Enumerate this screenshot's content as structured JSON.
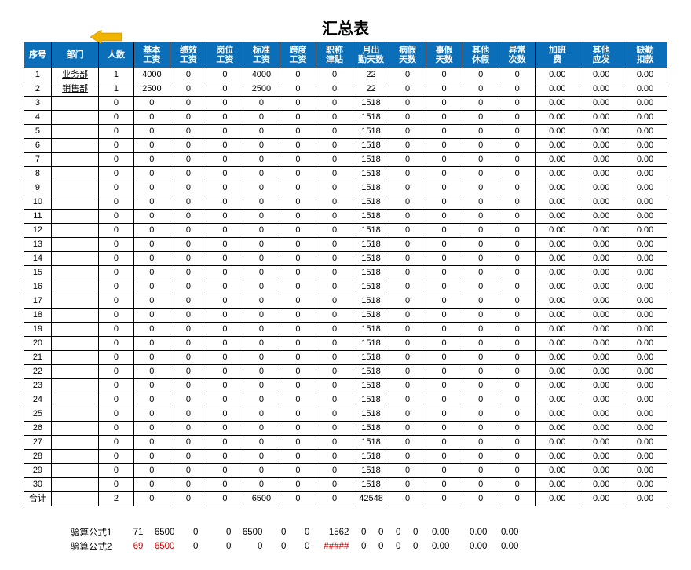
{
  "title": "汇总表",
  "headers": [
    "序号",
    "部门",
    "人数",
    "基本工资",
    "绩效工资",
    "岗位工资",
    "标准工资",
    "跨度工资",
    "职称津贴",
    "月出勤天数",
    "病假天数",
    "事假天数",
    "其他休假",
    "异常次数",
    "加班费",
    "其他应发",
    "缺勤扣款"
  ],
  "rows": [
    {
      "idx": "1",
      "dept": "业务部",
      "v": [
        "1",
        "4000",
        "0",
        "0",
        "4000",
        "0",
        "0",
        "22",
        "0",
        "0",
        "0",
        "0",
        "0.00",
        "0.00",
        "0.00"
      ]
    },
    {
      "idx": "2",
      "dept": "销售部",
      "v": [
        "1",
        "2500",
        "0",
        "0",
        "2500",
        "0",
        "0",
        "22",
        "0",
        "0",
        "0",
        "0",
        "0.00",
        "0.00",
        "0.00"
      ]
    },
    {
      "idx": "3",
      "dept": "",
      "v": [
        "0",
        "0",
        "0",
        "0",
        "0",
        "0",
        "0",
        "1518",
        "0",
        "0",
        "0",
        "0",
        "0.00",
        "0.00",
        "0.00"
      ]
    },
    {
      "idx": "4",
      "dept": "",
      "v": [
        "0",
        "0",
        "0",
        "0",
        "0",
        "0",
        "0",
        "1518",
        "0",
        "0",
        "0",
        "0",
        "0.00",
        "0.00",
        "0.00"
      ]
    },
    {
      "idx": "5",
      "dept": "",
      "v": [
        "0",
        "0",
        "0",
        "0",
        "0",
        "0",
        "0",
        "1518",
        "0",
        "0",
        "0",
        "0",
        "0.00",
        "0.00",
        "0.00"
      ]
    },
    {
      "idx": "6",
      "dept": "",
      "v": [
        "0",
        "0",
        "0",
        "0",
        "0",
        "0",
        "0",
        "1518",
        "0",
        "0",
        "0",
        "0",
        "0.00",
        "0.00",
        "0.00"
      ]
    },
    {
      "idx": "7",
      "dept": "",
      "v": [
        "0",
        "0",
        "0",
        "0",
        "0",
        "0",
        "0",
        "1518",
        "0",
        "0",
        "0",
        "0",
        "0.00",
        "0.00",
        "0.00"
      ]
    },
    {
      "idx": "8",
      "dept": "",
      "v": [
        "0",
        "0",
        "0",
        "0",
        "0",
        "0",
        "0",
        "1518",
        "0",
        "0",
        "0",
        "0",
        "0.00",
        "0.00",
        "0.00"
      ]
    },
    {
      "idx": "9",
      "dept": "",
      "v": [
        "0",
        "0",
        "0",
        "0",
        "0",
        "0",
        "0",
        "1518",
        "0",
        "0",
        "0",
        "0",
        "0.00",
        "0.00",
        "0.00"
      ]
    },
    {
      "idx": "10",
      "dept": "",
      "v": [
        "0",
        "0",
        "0",
        "0",
        "0",
        "0",
        "0",
        "1518",
        "0",
        "0",
        "0",
        "0",
        "0.00",
        "0.00",
        "0.00"
      ]
    },
    {
      "idx": "11",
      "dept": "",
      "v": [
        "0",
        "0",
        "0",
        "0",
        "0",
        "0",
        "0",
        "1518",
        "0",
        "0",
        "0",
        "0",
        "0.00",
        "0.00",
        "0.00"
      ]
    },
    {
      "idx": "12",
      "dept": "",
      "v": [
        "0",
        "0",
        "0",
        "0",
        "0",
        "0",
        "0",
        "1518",
        "0",
        "0",
        "0",
        "0",
        "0.00",
        "0.00",
        "0.00"
      ]
    },
    {
      "idx": "13",
      "dept": "",
      "v": [
        "0",
        "0",
        "0",
        "0",
        "0",
        "0",
        "0",
        "1518",
        "0",
        "0",
        "0",
        "0",
        "0.00",
        "0.00",
        "0.00"
      ]
    },
    {
      "idx": "14",
      "dept": "",
      "v": [
        "0",
        "0",
        "0",
        "0",
        "0",
        "0",
        "0",
        "1518",
        "0",
        "0",
        "0",
        "0",
        "0.00",
        "0.00",
        "0.00"
      ]
    },
    {
      "idx": "15",
      "dept": "",
      "v": [
        "0",
        "0",
        "0",
        "0",
        "0",
        "0",
        "0",
        "1518",
        "0",
        "0",
        "0",
        "0",
        "0.00",
        "0.00",
        "0.00"
      ]
    },
    {
      "idx": "16",
      "dept": "",
      "v": [
        "0",
        "0",
        "0",
        "0",
        "0",
        "0",
        "0",
        "1518",
        "0",
        "0",
        "0",
        "0",
        "0.00",
        "0.00",
        "0.00"
      ]
    },
    {
      "idx": "17",
      "dept": "",
      "v": [
        "0",
        "0",
        "0",
        "0",
        "0",
        "0",
        "0",
        "1518",
        "0",
        "0",
        "0",
        "0",
        "0.00",
        "0.00",
        "0.00"
      ]
    },
    {
      "idx": "18",
      "dept": "",
      "v": [
        "0",
        "0",
        "0",
        "0",
        "0",
        "0",
        "0",
        "1518",
        "0",
        "0",
        "0",
        "0",
        "0.00",
        "0.00",
        "0.00"
      ]
    },
    {
      "idx": "19",
      "dept": "",
      "v": [
        "0",
        "0",
        "0",
        "0",
        "0",
        "0",
        "0",
        "1518",
        "0",
        "0",
        "0",
        "0",
        "0.00",
        "0.00",
        "0.00"
      ]
    },
    {
      "idx": "20",
      "dept": "",
      "v": [
        "0",
        "0",
        "0",
        "0",
        "0",
        "0",
        "0",
        "1518",
        "0",
        "0",
        "0",
        "0",
        "0.00",
        "0.00",
        "0.00"
      ]
    },
    {
      "idx": "21",
      "dept": "",
      "v": [
        "0",
        "0",
        "0",
        "0",
        "0",
        "0",
        "0",
        "1518",
        "0",
        "0",
        "0",
        "0",
        "0.00",
        "0.00",
        "0.00"
      ]
    },
    {
      "idx": "22",
      "dept": "",
      "v": [
        "0",
        "0",
        "0",
        "0",
        "0",
        "0",
        "0",
        "1518",
        "0",
        "0",
        "0",
        "0",
        "0.00",
        "0.00",
        "0.00"
      ]
    },
    {
      "idx": "23",
      "dept": "",
      "v": [
        "0",
        "0",
        "0",
        "0",
        "0",
        "0",
        "0",
        "1518",
        "0",
        "0",
        "0",
        "0",
        "0.00",
        "0.00",
        "0.00"
      ]
    },
    {
      "idx": "24",
      "dept": "",
      "v": [
        "0",
        "0",
        "0",
        "0",
        "0",
        "0",
        "0",
        "1518",
        "0",
        "0",
        "0",
        "0",
        "0.00",
        "0.00",
        "0.00"
      ]
    },
    {
      "idx": "25",
      "dept": "",
      "v": [
        "0",
        "0",
        "0",
        "0",
        "0",
        "0",
        "0",
        "1518",
        "0",
        "0",
        "0",
        "0",
        "0.00",
        "0.00",
        "0.00"
      ]
    },
    {
      "idx": "26",
      "dept": "",
      "v": [
        "0",
        "0",
        "0",
        "0",
        "0",
        "0",
        "0",
        "1518",
        "0",
        "0",
        "0",
        "0",
        "0.00",
        "0.00",
        "0.00"
      ]
    },
    {
      "idx": "27",
      "dept": "",
      "v": [
        "0",
        "0",
        "0",
        "0",
        "0",
        "0",
        "0",
        "1518",
        "0",
        "0",
        "0",
        "0",
        "0.00",
        "0.00",
        "0.00"
      ]
    },
    {
      "idx": "28",
      "dept": "",
      "v": [
        "0",
        "0",
        "0",
        "0",
        "0",
        "0",
        "0",
        "1518",
        "0",
        "0",
        "0",
        "0",
        "0.00",
        "0.00",
        "0.00"
      ]
    },
    {
      "idx": "29",
      "dept": "",
      "v": [
        "0",
        "0",
        "0",
        "0",
        "0",
        "0",
        "0",
        "1518",
        "0",
        "0",
        "0",
        "0",
        "0.00",
        "0.00",
        "0.00"
      ]
    },
    {
      "idx": "30",
      "dept": "",
      "v": [
        "0",
        "0",
        "0",
        "0",
        "0",
        "0",
        "0",
        "1518",
        "0",
        "0",
        "0",
        "0",
        "0.00",
        "0.00",
        "0.00"
      ]
    }
  ],
  "total": {
    "label": "合计",
    "v": [
      "2",
      "0",
      "0",
      "0",
      "6500",
      "0",
      "0",
      "42548",
      "0",
      "0",
      "0",
      "0",
      "0.00",
      "0.00",
      "0.00"
    ]
  },
  "calc_col_widths": [
    34,
    40,
    30,
    42,
    40,
    30,
    30,
    50,
    22,
    22,
    22,
    22,
    40,
    48,
    40
  ],
  "calc": [
    {
      "label": "验算公式1",
      "red": false,
      "v": [
        "71",
        "6500",
        "0",
        "0",
        "6500",
        "0",
        "0",
        "1562",
        "0",
        "0",
        "0",
        "0",
        "0.00",
        "0.00",
        "0.00"
      ]
    },
    {
      "label": "验算公式2",
      "red": true,
      "v": [
        "69",
        "6500",
        "0",
        "0",
        "0",
        "0",
        "0",
        "#####",
        "0",
        "0",
        "0",
        "0",
        "0.00",
        "0.00",
        "0.00"
      ],
      "red_cols": [
        0,
        1,
        7
      ]
    }
  ]
}
